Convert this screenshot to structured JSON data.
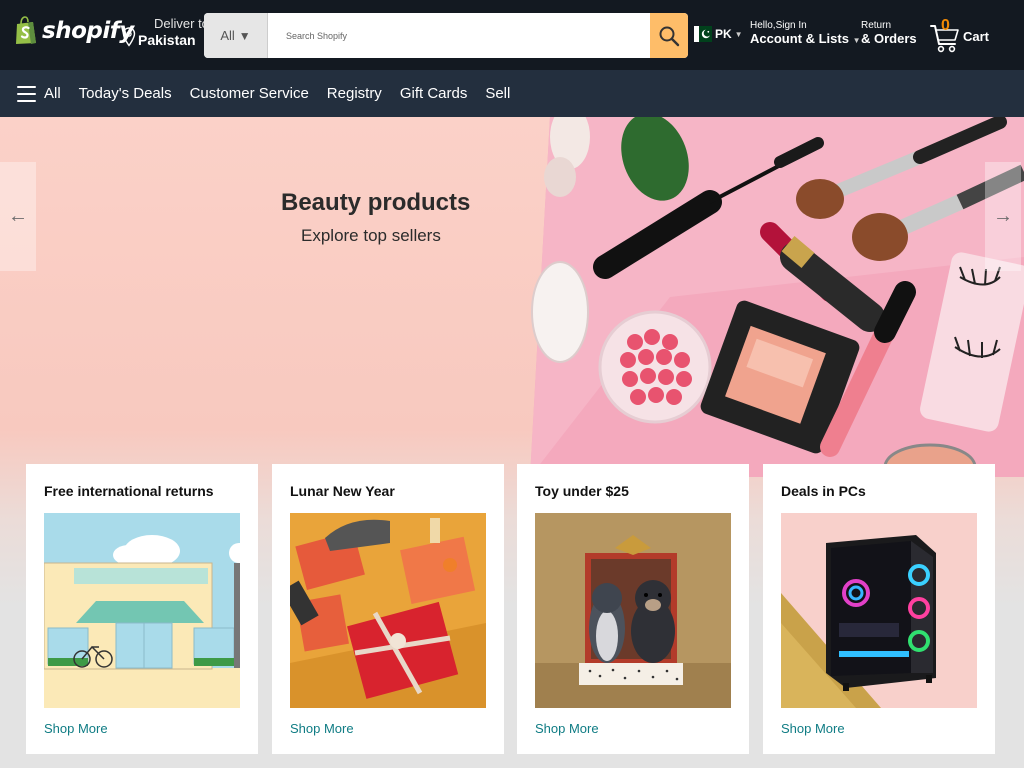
{
  "header": {
    "logo_text": "shopify",
    "deliver_label": "Deliver to",
    "deliver_location": "Pakistan",
    "search_category": "All",
    "search_placeholder": "Search Shopify",
    "language": "PK",
    "account_greeting": "Hello,Sign In",
    "account_label": "Account & Lists",
    "returns_label": "Return",
    "orders_label": "& Orders",
    "cart_count": "0",
    "cart_label": "Cart"
  },
  "nav": {
    "all_label": "All",
    "items": [
      "Today's Deals",
      "Customer Service",
      "Registry",
      "Gift Cards",
      "Sell"
    ]
  },
  "hero": {
    "title": "Beauty products",
    "subtitle": "Explore top sellers",
    "prev_arrow": "←",
    "next_arrow": "→"
  },
  "cards": [
    {
      "title": "Free international returns",
      "link": "Shop More"
    },
    {
      "title": "Lunar New Year",
      "link": "Shop More"
    },
    {
      "title": "Toy under $25",
      "link": "Shop More"
    },
    {
      "title": "Deals in PCs",
      "link": "Shop More"
    }
  ],
  "colors": {
    "header_bg": "#131921",
    "nav_bg": "#232f3e",
    "search_button": "#febd69",
    "cart_count": "#f08804",
    "link": "#0f7c84",
    "hero_bg": "#fbd1c8"
  },
  "icons": {
    "logo": "shopify-bag-icon",
    "deliver": "location-pin-icon",
    "search": "search-icon",
    "flag": "pakistan-flag-icon",
    "cart": "cart-icon",
    "menu": "hamburger-menu-icon"
  }
}
